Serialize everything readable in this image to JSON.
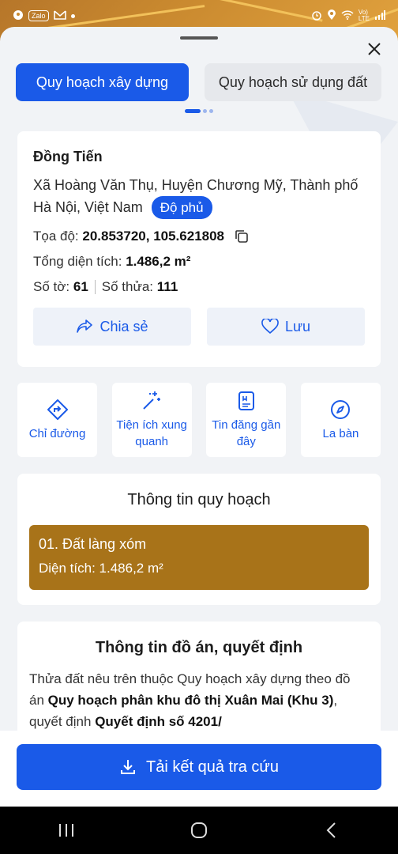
{
  "status_bar": {
    "left_icons": [
      "map-icon",
      "zalo-icon",
      "gmail-icon",
      "dot-icon"
    ],
    "right_icons": [
      "alarm-icon",
      "location-icon",
      "wifi-icon",
      "volte-icon",
      "signal-icon"
    ]
  },
  "tabs": [
    {
      "label": "Quy hoạch xây dựng",
      "active": true
    },
    {
      "label": "Quy hoạch sử dụng đất",
      "active": false
    }
  ],
  "place": {
    "name": "Đồng Tiến",
    "address": "Xã Hoàng Văn Thụ, Huyện Chương Mỹ, Thành phố Hà Nội, Việt Nam",
    "badge": "Độ phủ",
    "coord_label": "Tọa độ:",
    "coord_value": "20.853720, 105.621808",
    "area_label": "Tổng diện tích:",
    "area_value": "1.486,2 m²",
    "sheet_label": "Số tờ:",
    "sheet_value": "61",
    "parcel_label": "Số thửa:",
    "parcel_value": "111",
    "share_label": "Chia sẻ",
    "save_label": "Lưu"
  },
  "quick_actions": [
    {
      "label": "Chỉ đường",
      "icon": "directions-icon"
    },
    {
      "label": "Tiện ích xung quanh",
      "icon": "sparkle-icon"
    },
    {
      "label": "Tin đăng gần đây",
      "icon": "listing-icon"
    },
    {
      "label": "La bàn",
      "icon": "compass-icon"
    }
  ],
  "planning": {
    "title": "Thông tin quy hoạch",
    "item_title": "01. Đất làng xóm",
    "item_area": "Diện tích: 1.486,2 m²",
    "item_color": "#a87319"
  },
  "project": {
    "title": "Thông tin đồ án, quyết định",
    "text_1": "Thửa đất nêu trên thuộc Quy hoạch xây dựng theo đồ án ",
    "text_bold_1": "Quy hoạch phân khu đô thị Xuân Mai (Khu 3)",
    "text_2": ", quyết định ",
    "text_bold_2": "Quyết định số 4201/"
  },
  "download_label": "Tải kết quả tra cứu",
  "colors": {
    "accent": "#1a5ae8",
    "plan_item": "#a87319"
  }
}
